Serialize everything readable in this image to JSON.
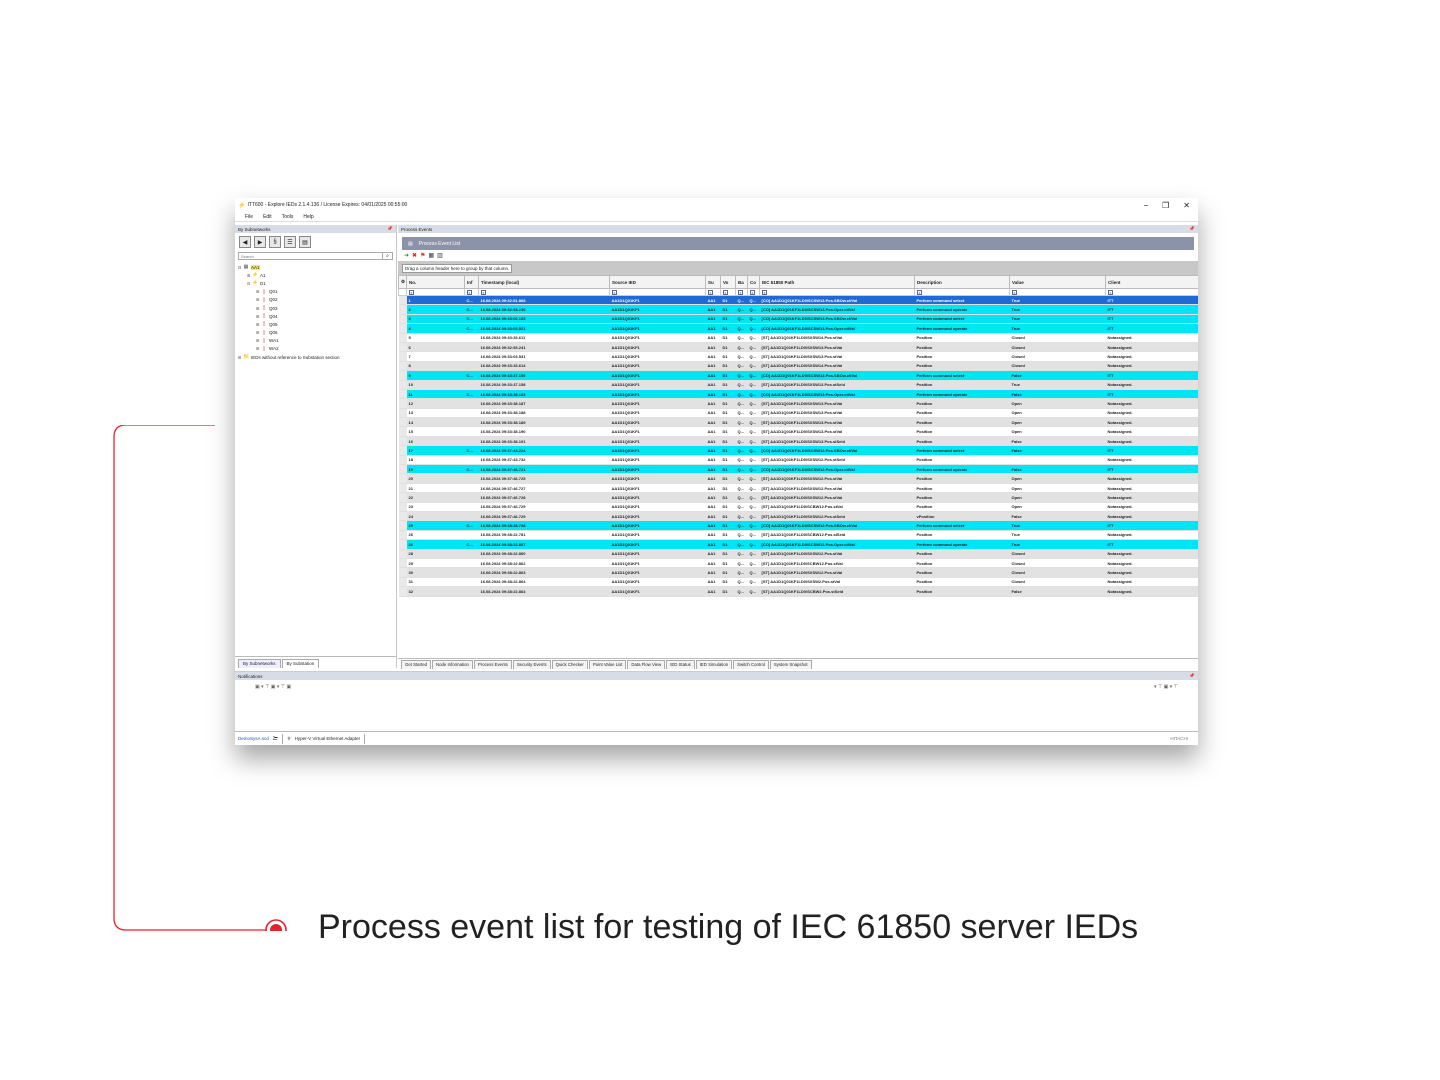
{
  "window": {
    "title": "ITT600 - Explore IEDs 2.1.4.136  / License Expires:  04/01/2025 00:55:00",
    "controls": [
      "−",
      "❐",
      "✕"
    ]
  },
  "menu": [
    "File",
    "Edit",
    "Tools",
    "Help"
  ],
  "left_pane": {
    "header": "By Subnetworks",
    "search_placeholder": "Search",
    "tree": [
      {
        "level": 0,
        "exp": "⊟",
        "icon": "▦",
        "label": "AA1"
      },
      {
        "level": 1,
        "exp": "⊞",
        "icon": "⚡",
        "label": "A1"
      },
      {
        "level": 1,
        "exp": "⊟",
        "icon": "⚡",
        "label": "D1"
      },
      {
        "level": 2,
        "exp": "⊞",
        "icon": "▯",
        "label": "Q01"
      },
      {
        "level": 2,
        "exp": "⊞",
        "icon": "▯",
        "label": "Q02"
      },
      {
        "level": 2,
        "exp": "⊞",
        "icon": "▯",
        "label": "Q03"
      },
      {
        "level": 2,
        "exp": "⊞",
        "icon": "▯",
        "label": "Q04"
      },
      {
        "level": 2,
        "exp": "⊞",
        "icon": "▯",
        "label": "Q05"
      },
      {
        "level": 2,
        "exp": "⊞",
        "icon": "▯",
        "label": "Q06"
      },
      {
        "level": 2,
        "exp": "⊞",
        "icon": "▯",
        "label": "WA1"
      },
      {
        "level": 2,
        "exp": "⊞",
        "icon": "▯",
        "label": "WA2"
      },
      {
        "level": 0,
        "exp": "⊞",
        "icon": "📁",
        "label": "IEDs without reference to Substation section"
      }
    ],
    "tabs": [
      "By Subnetworks",
      "By Substation"
    ]
  },
  "right_pane": {
    "header": "Process Events",
    "list_title": "Process Event List",
    "group_hint": "Drag a column header here to group by that column.",
    "columns": [
      "No.",
      "Inf",
      "Timestamp (local)",
      "Source IED",
      "Su",
      "Vo",
      "Ba",
      "Co",
      "IEC 61850 Path",
      "Description",
      "Value",
      "Client"
    ],
    "rows": [
      [
        "1",
        "C...",
        "16.08.2024 09:32:51.868",
        "AA1D1Q01KF1",
        "AA1",
        "D1",
        "Q...",
        "Q...",
        "[CO] AA1D1Q01KF1LD0/SCSW13.Pos.SBOw.ctlVal",
        "Perform command select",
        "True",
        "ITT"
      ],
      [
        "2",
        "C...",
        "16.08.2024 09:32:53.230",
        "AA1D1Q01KF1",
        "AA1",
        "D1",
        "Q...",
        "Q...",
        "[CO] AA1D1Q01KF1LD0/SCSW13.Pos.Oper.ctlVal",
        "Perform command operate",
        "True",
        "ITT"
      ],
      [
        "3",
        "C...",
        "16.08.2024 09:33:02.183",
        "AA1D1Q01KF1",
        "AA1",
        "D1",
        "Q...",
        "Q...",
        "[CO] AA1D1Q01KF1LD0/SCSW13.Pos.SBOw.ctlVal",
        "Perform command select",
        "True",
        "ITT"
      ],
      [
        "4",
        "C...",
        "16.08.2024 09:33:03.521",
        "AA1D1Q01KF1",
        "AA1",
        "D1",
        "Q...",
        "Q...",
        "[CO] AA1D1Q01KF1LD0/SCSW13.Pos.Oper.ctlVal",
        "Perform command operate",
        "True",
        "ITT"
      ],
      [
        "5",
        "",
        "16.08.2024 09:33:33.611",
        "AA1D1Q01KF1",
        "AA1",
        "D1",
        "Q...",
        "Q...",
        "[ST] AA1D1Q01KF1LD0/SXSW14.Pos.stVal",
        "Position",
        "Closed",
        "Notassigned."
      ],
      [
        "6",
        "",
        "16.08.2024 09:32:53.241",
        "AA1D1Q01KF1",
        "AA1",
        "D1",
        "Q...",
        "Q...",
        "[ST] AA1D1Q01KF1LD0/SXSW13.Pos.stVal",
        "Position",
        "Closed",
        "Notassigned."
      ],
      [
        "7",
        "",
        "16.08.2024 09:33:03.531",
        "AA1D1Q01KF1",
        "AA1",
        "D1",
        "Q...",
        "Q...",
        "[ST] AA1D1Q01KF1LD0/SXSW13.Pos.stVal",
        "Position",
        "Closed",
        "Notassigned."
      ],
      [
        "8",
        "",
        "16.08.2024 09:33:33.614",
        "AA1D1Q01KF1",
        "AA1",
        "D1",
        "Q...",
        "Q...",
        "[ST] AA1D1Q01KF1LD0/SXSW14.Pos.stVal",
        "Position",
        "Closed",
        "Notassigned."
      ],
      [
        "9",
        "C...",
        "16.08.2024 09:33:37.156",
        "AA1D1Q01KF1",
        "AA1",
        "D1",
        "Q...",
        "Q...",
        "[CO] AA1D1Q01KF1LD0/SCSW13.Pos.SBOw.ctlVal",
        "Perform command select",
        "False",
        "ITT"
      ],
      [
        "10",
        "",
        "16.08.2024 09:33:37.158",
        "AA1D1Q01KF1",
        "AA1",
        "D1",
        "Q...",
        "Q...",
        "[ST] AA1D1Q01KF1LD0/SXSW13.Pos.stSeld",
        "Position",
        "True",
        "Notassigned."
      ],
      [
        "11",
        "C...",
        "16.08.2024 09:33:38.183",
        "AA1D1Q01KF1",
        "AA1",
        "D1",
        "Q...",
        "Q...",
        "[CO] AA1D1Q01KF1LD0/SCSW13.Pos.Oper.ctlVal",
        "Perform command operate",
        "False",
        "ITT"
      ],
      [
        "12",
        "",
        "16.08.2024 09:33:38.187",
        "AA1D1Q01KF1",
        "AA1",
        "D1",
        "Q...",
        "Q...",
        "[ST] AA1D1Q01KF1LD0/SXSW13.Pos.stVal",
        "Position",
        "Open",
        "Notassigned."
      ],
      [
        "13",
        "",
        "16.08.2024 09:33:38.188",
        "AA1D1Q01KF1",
        "AA1",
        "D1",
        "Q...",
        "Q...",
        "[ST] AA1D1Q01KF1LD0/SXSW13.Pos.stVal",
        "Position",
        "Open",
        "Notassigned."
      ],
      [
        "14",
        "",
        "16.08.2024 09:33:38.189",
        "AA1D1Q01KF1",
        "AA1",
        "D1",
        "Q...",
        "Q...",
        "[ST] AA1D1Q01KF1LD0/SXSW13.Pos.stVal",
        "Position",
        "Open",
        "Notassigned."
      ],
      [
        "15",
        "",
        "16.08.2024 09:33:38.190",
        "AA1D1Q01KF1",
        "AA1",
        "D1",
        "Q...",
        "Q...",
        "[ST] AA1D1Q01KF1LD0/SXSW13.Pos.stVal",
        "Position",
        "Open",
        "Notassigned."
      ],
      [
        "16",
        "",
        "16.08.2024 09:33:38.191",
        "AA1D1Q01KF1",
        "AA1",
        "D1",
        "Q...",
        "Q...",
        "[ST] AA1D1Q01KF1LD0/SXSW13.Pos.stSeld",
        "Position",
        "False",
        "Notassigned."
      ],
      [
        "17",
        "C...",
        "16.08.2024 09:37:43.224",
        "AA1D1Q01KF1",
        "AA1",
        "D1",
        "Q...",
        "Q...",
        "[CO] AA1D1Q01KF1LD0/SCSW12.Pos.SBOw.ctlVal",
        "Perform command select",
        "False",
        "ITT"
      ],
      [
        "18",
        "",
        "16.08.2024 09:37:43.732",
        "AA1D1Q01KF1",
        "AA1",
        "D1",
        "Q...",
        "Q...",
        "[ST] AA1D1Q01KF1LD0/SXSW12.Pos.stSeld",
        "Position",
        "",
        "Notassigned."
      ],
      [
        "19",
        "C...",
        "16.08.2024 09:37:46.721",
        "AA1D1Q01KF1",
        "AA1",
        "D1",
        "Q...",
        "Q...",
        "[CO] AA1D1Q01KF1LD0/SCSW12.Pos.Oper.ctlVal",
        "Perform command operate",
        "False",
        "ITT"
      ],
      [
        "20",
        "",
        "16.08.2024 09:37:46.725",
        "AA1D1Q01KF1",
        "AA1",
        "D1",
        "Q...",
        "Q...",
        "[ST] AA1D1Q01KF1LD0/SXSW12.Pos.stVal",
        "Position",
        "Open",
        "Notassigned."
      ],
      [
        "21",
        "",
        "16.08.2024 09:37:46.727",
        "AA1D1Q01KF1",
        "AA1",
        "D1",
        "Q...",
        "Q...",
        "[ST] AA1D1Q01KF1LD0/SXSW12.Pos.stVal",
        "Position",
        "Open",
        "Notassigned."
      ],
      [
        "22",
        "",
        "16.08.2024 09:37:46.728",
        "AA1D1Q01KF1",
        "AA1",
        "D1",
        "Q...",
        "Q...",
        "[ST] AA1D1Q01KF1LD0/SXSW12.Pos.stVal",
        "Position",
        "Open",
        "Notassigned."
      ],
      [
        "23",
        "",
        "16.08.2024 09:37:46.729",
        "AA1D1Q01KF1",
        "AA1",
        "D1",
        "Q...",
        "Q...",
        "[ST] AA1D1Q01KF1LD0/SCBW12.Pos.stVal",
        "Position",
        "Open",
        "Notassigned."
      ],
      [
        "24",
        "",
        "16.08.2024 09:37:46.729",
        "AA1D1Q01KF1",
        "AA1",
        "D1",
        "Q...",
        "Q...",
        "[ST] AA1D1Q01KF1LD0/SXSW12.Pos.stSeld",
        "vPosition",
        "False",
        "Notassigned."
      ],
      [
        "25",
        "C...",
        "16.08.2024 09:38:28.798",
        "AA1D1Q01KF1",
        "AA1",
        "D1",
        "Q...",
        "Q...",
        "[CO] AA1D1Q01KF1LD0/SCSW12.Pos.SBOw.ctlVal",
        "Perform command select",
        "True",
        "ITT"
      ],
      [
        "26",
        "",
        "16.08.2024 09:38:22.781",
        "AA1D1Q01KF1",
        "AA1",
        "D1",
        "Q...",
        "Q...",
        "[ST] AA1D1Q01KF1LD0/SCBW12.Pos.stSeld",
        "Position",
        "True",
        "Notassigned."
      ],
      [
        "26",
        "C...",
        "16.08.2024 09:38:22.857",
        "AA1D1Q01KF1",
        "AA1",
        "D1",
        "Q...",
        "Q...",
        "[CO] AA1D1Q01KF1LD0/SCSW12.Pos.Oper.ctlVal",
        "Perform command operate",
        "True",
        "ITT"
      ],
      [
        "28",
        "",
        "16.08.2024 09:38:22.860",
        "AA1D1Q01KF1",
        "AA1",
        "D1",
        "Q...",
        "Q...",
        "[ST] AA1D1Q01KF1LD0/SXSW12.Pos.stVal",
        "Position",
        "Closed",
        "Notassigned."
      ],
      [
        "29",
        "",
        "16.08.2024 09:38:22.862",
        "AA1D1Q01KF1",
        "AA1",
        "D1",
        "Q...",
        "Q...",
        "[ST] AA1D1Q01KF1LD0/SCBW12.Pos.stVal",
        "Position",
        "Closed",
        "Notassigned."
      ],
      [
        "30",
        "",
        "16.08.2024 09:38:22.863",
        "AA1D1Q01KF1",
        "AA1",
        "D1",
        "Q...",
        "Q...",
        "[ST] AA1D1Q01KF1LD0/SXSW12.Pos.stVal",
        "Position",
        "Closed",
        "Notassigned."
      ],
      [
        "31",
        "",
        "16.08.2024 09:38:22.864",
        "AA1D1Q01KF1",
        "AA1",
        "D1",
        "Q...",
        "Q...",
        "[ST] AA1D1Q01KF1LD0/SXSW2.Pos.stVal",
        "Position",
        "Closed",
        "Notassigned."
      ],
      [
        "32",
        "",
        "16.08.2024 09:38:22.864",
        "AA1D1Q01KF1",
        "AA1",
        "D1",
        "Q...",
        "Q...",
        "[ST] AA1D1Q01KF1LD0/SCBW2.Pos.stSeld",
        "Position",
        "False",
        "Notassigned."
      ]
    ],
    "row_styles": [
      "sel",
      "cyan",
      "cyan",
      "cyan",
      "white",
      "grey",
      "white",
      "grey",
      "cyan",
      "grey",
      "cyan",
      "grey",
      "white",
      "grey",
      "white",
      "grey",
      "cyan",
      "white",
      "cyan",
      "grey",
      "white",
      "grey",
      "white",
      "grey",
      "cyan",
      "white",
      "cyan",
      "grey",
      "white",
      "grey",
      "white",
      "grey"
    ],
    "tabs": [
      "Get Started",
      "Node Information",
      "Process Events",
      "Security Events",
      "Quick Checker",
      "Point Value List",
      "Data Flow View",
      "IED Status",
      "IED Simulation",
      "Switch Control",
      "System Snapshot"
    ]
  },
  "notifications": {
    "header": "Notifications"
  },
  "statusbar": {
    "file": "DemoSysA.scd",
    "adapter": "Hyper-V Virtual Ethernet Adapter",
    "right": "HITACHI"
  },
  "caption": "Process event list for testing of IEC 61850 server IEDs",
  "colors": {
    "selected": "#1f6bd6",
    "highlight": "#00e5f3",
    "accent": "#e8202a"
  }
}
